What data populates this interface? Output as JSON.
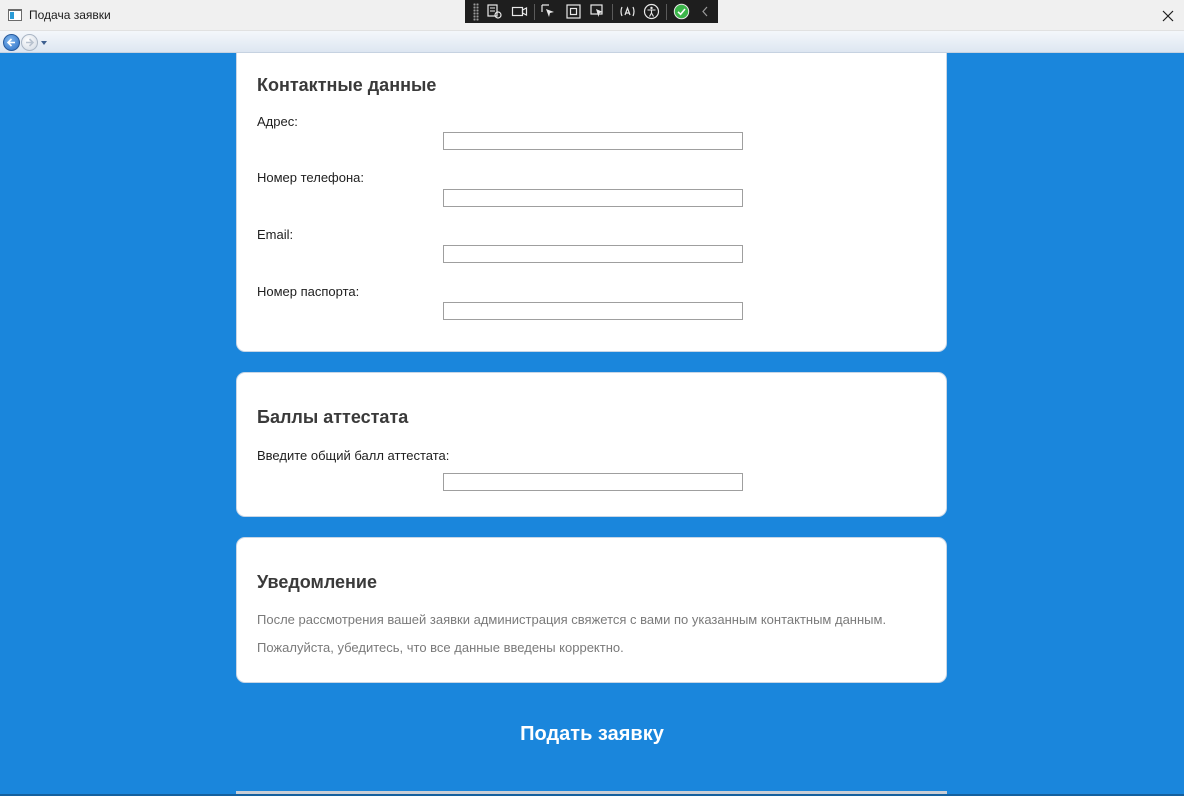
{
  "window": {
    "title": "Подача заявки"
  },
  "debug_toolbar": {
    "buttons": [
      "select-element-icon",
      "camera-icon",
      "pointer-icon",
      "bounds-icon",
      "focus-icon",
      "display-layout-icon",
      "accessibility-icon",
      "track-focus-check-icon",
      "collapse-chevron-icon"
    ]
  },
  "contacts": {
    "heading": "Контактные данные",
    "address_label": "Адрес:",
    "address_value": "",
    "phone_label": "Номер телефона:",
    "phone_value": "",
    "email_label": "Email:",
    "email_value": "",
    "passport_label": "Номер паспорта:",
    "passport_value": ""
  },
  "scores": {
    "heading": "Баллы аттестата",
    "score_label": "Введите общий балл аттестата:",
    "score_value": ""
  },
  "notice": {
    "heading": "Уведомление",
    "line1": "После рассмотрения вашей заявки администрация свяжется с вами по указанным контактным данным.",
    "line2": "Пожалуйста, убедитесь, что все данные введены корректно."
  },
  "submit_label": "Подать заявку",
  "colors": {
    "background": "#1a86dc",
    "card": "#ffffff",
    "heading": "#3a3a3a",
    "note_text": "#7a7a7a"
  }
}
